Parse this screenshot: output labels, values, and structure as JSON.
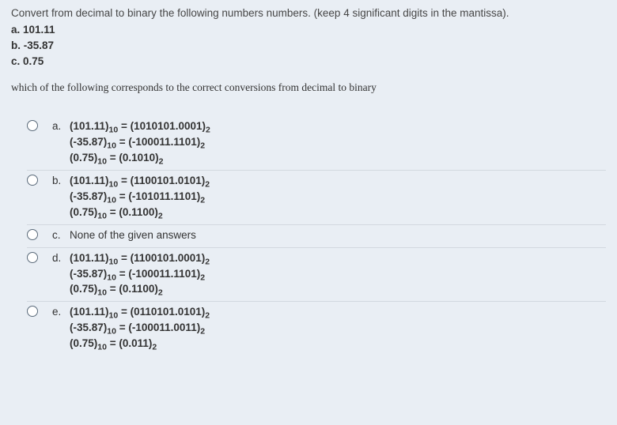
{
  "intro": "Convert from decimal to binary the following numbers numbers. (keep 4 significant digits in the mantissa).",
  "given": {
    "a": "a. 101.11",
    "b": "b. -35.87",
    "c": "c. 0.75"
  },
  "subprompt": "which of the following corresponds to the correct conversions from decimal to binary",
  "options": {
    "a": {
      "letter": "a.",
      "l1": {
        "lhs": "(101.11)",
        "lsub": "10",
        "eq": " = ",
        "rhs": "(1010101.0001)",
        "rsub": "2"
      },
      "l2": {
        "lhs": "(-35.87)",
        "lsub": "10",
        "eq": " = ",
        "rhs": "(-100011.1101)",
        "rsub": "2"
      },
      "l3": {
        "lhs": "(0.75)",
        "lsub": "10",
        "eq": " = ",
        "rhs": "(0.1010)",
        "rsub": "2"
      }
    },
    "b": {
      "letter": "b.",
      "l1": {
        "lhs": "(101.11)",
        "lsub": "10",
        "eq": " = ",
        "rhs": "(1100101.0101)",
        "rsub": "2"
      },
      "l2": {
        "lhs": "(-35.87)",
        "lsub": "10",
        "eq": " = ",
        "rhs": "(-101011.1101)",
        "rsub": "2"
      },
      "l3": {
        "lhs": "(0.75)",
        "lsub": "10",
        "eq": " = ",
        "rhs": "(0.1100)",
        "rsub": "2"
      }
    },
    "c": {
      "letter": "c.",
      "text": "None of the given answers"
    },
    "d": {
      "letter": "d.",
      "l1": {
        "lhs": "(101.11)",
        "lsub": "10",
        "eq": " = ",
        "rhs": "(1100101.0001)",
        "rsub": "2"
      },
      "l2": {
        "lhs": "(-35.87)",
        "lsub": "10",
        "eq": " = ",
        "rhs": "(-100011.1101)",
        "rsub": "2"
      },
      "l3": {
        "lhs": "(0.75)",
        "lsub": "10",
        "eq": " = ",
        "rhs": "(0.1100)",
        "rsub": "2"
      }
    },
    "e": {
      "letter": "e.",
      "l1": {
        "lhs": "(101.11)",
        "lsub": "10",
        "eq": " = ",
        "rhs": "(0110101.0101)",
        "rsub": "2"
      },
      "l2": {
        "lhs": "(-35.87)",
        "lsub": "10",
        "eq": " = ",
        "rhs": "(-100011.0011)",
        "rsub": "2"
      },
      "l3": {
        "lhs": "(0.75)",
        "lsub": "10",
        "eq": " = ",
        "rhs": "(0.011)",
        "rsub": "2"
      }
    }
  }
}
